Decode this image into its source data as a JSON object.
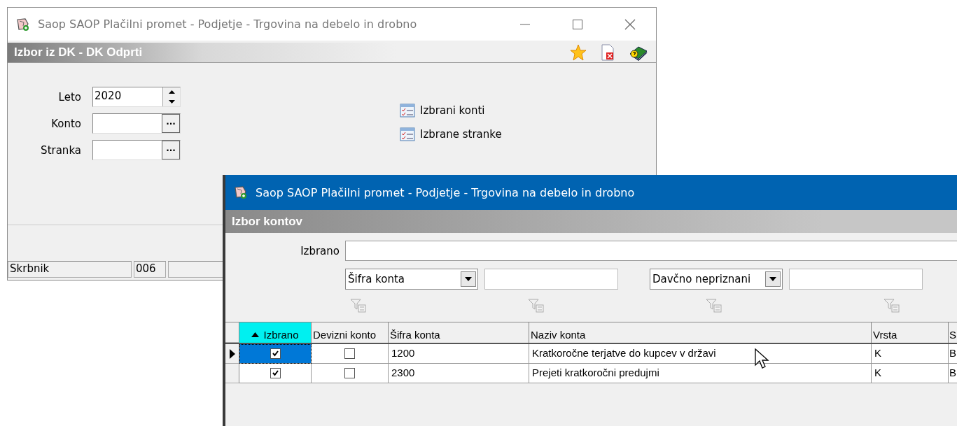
{
  "main_window": {
    "title": "Saop SAOP Plačilni promet - Podjetje - Trgovina na debelo in drobno",
    "active": false,
    "header": "Izbor iz DK - DK Odprti",
    "fields": [
      {
        "label": "Leto",
        "value": "2020",
        "kind": "spinner"
      },
      {
        "label": "Konto",
        "kind": "lookup"
      },
      {
        "label": "Stranka",
        "kind": "lookup"
      }
    ],
    "lookup_button": "···",
    "links": [
      "Izbrani konti",
      "Izbrane stranke"
    ],
    "status_bar": [
      "Skrbnik",
      "006"
    ]
  },
  "dialog": {
    "title": "Saop SAOP Plačilni promet - Podjetje - Trgovina na debelo in drobno",
    "active": true,
    "header": "Izbor kontov",
    "selected_field": {
      "label": "Izbrano"
    },
    "filters": [
      {
        "value": "Šifra konta"
      },
      {
        "value": "Davčno nepriznani"
      }
    ],
    "table": {
      "columns": [
        {
          "label": "Izbrano",
          "sorted": true
        },
        {
          "label": "Devizni konto",
          "sorted": false
        },
        {
          "label": "Šifra konta",
          "sorted": false
        },
        {
          "label": "Naziv konta",
          "sorted": false
        },
        {
          "label": "Vrsta",
          "sorted": false
        },
        {
          "label": "S",
          "sorted": false
        }
      ],
      "rows": [
        {
          "selected": true,
          "cells": [
            {
              "kind": "checkbox",
              "checked": true
            },
            {
              "kind": "checkbox",
              "checked": false
            },
            {
              "kind": "text",
              "text": "1200"
            },
            {
              "kind": "text",
              "text": "Kratkoročne terjatve do kupcev v državi"
            },
            {
              "kind": "text",
              "text": "K"
            },
            {
              "kind": "text",
              "text": "B"
            }
          ]
        },
        {
          "selected": false,
          "cells": [
            {
              "kind": "checkbox",
              "checked": true
            },
            {
              "kind": "checkbox",
              "checked": false
            },
            {
              "kind": "text",
              "text": "2300"
            },
            {
              "kind": "text",
              "text": "Prejeti kratkoročni predujmi"
            },
            {
              "kind": "text",
              "text": "K"
            },
            {
              "kind": "text",
              "text": "B"
            }
          ]
        }
      ]
    }
  }
}
